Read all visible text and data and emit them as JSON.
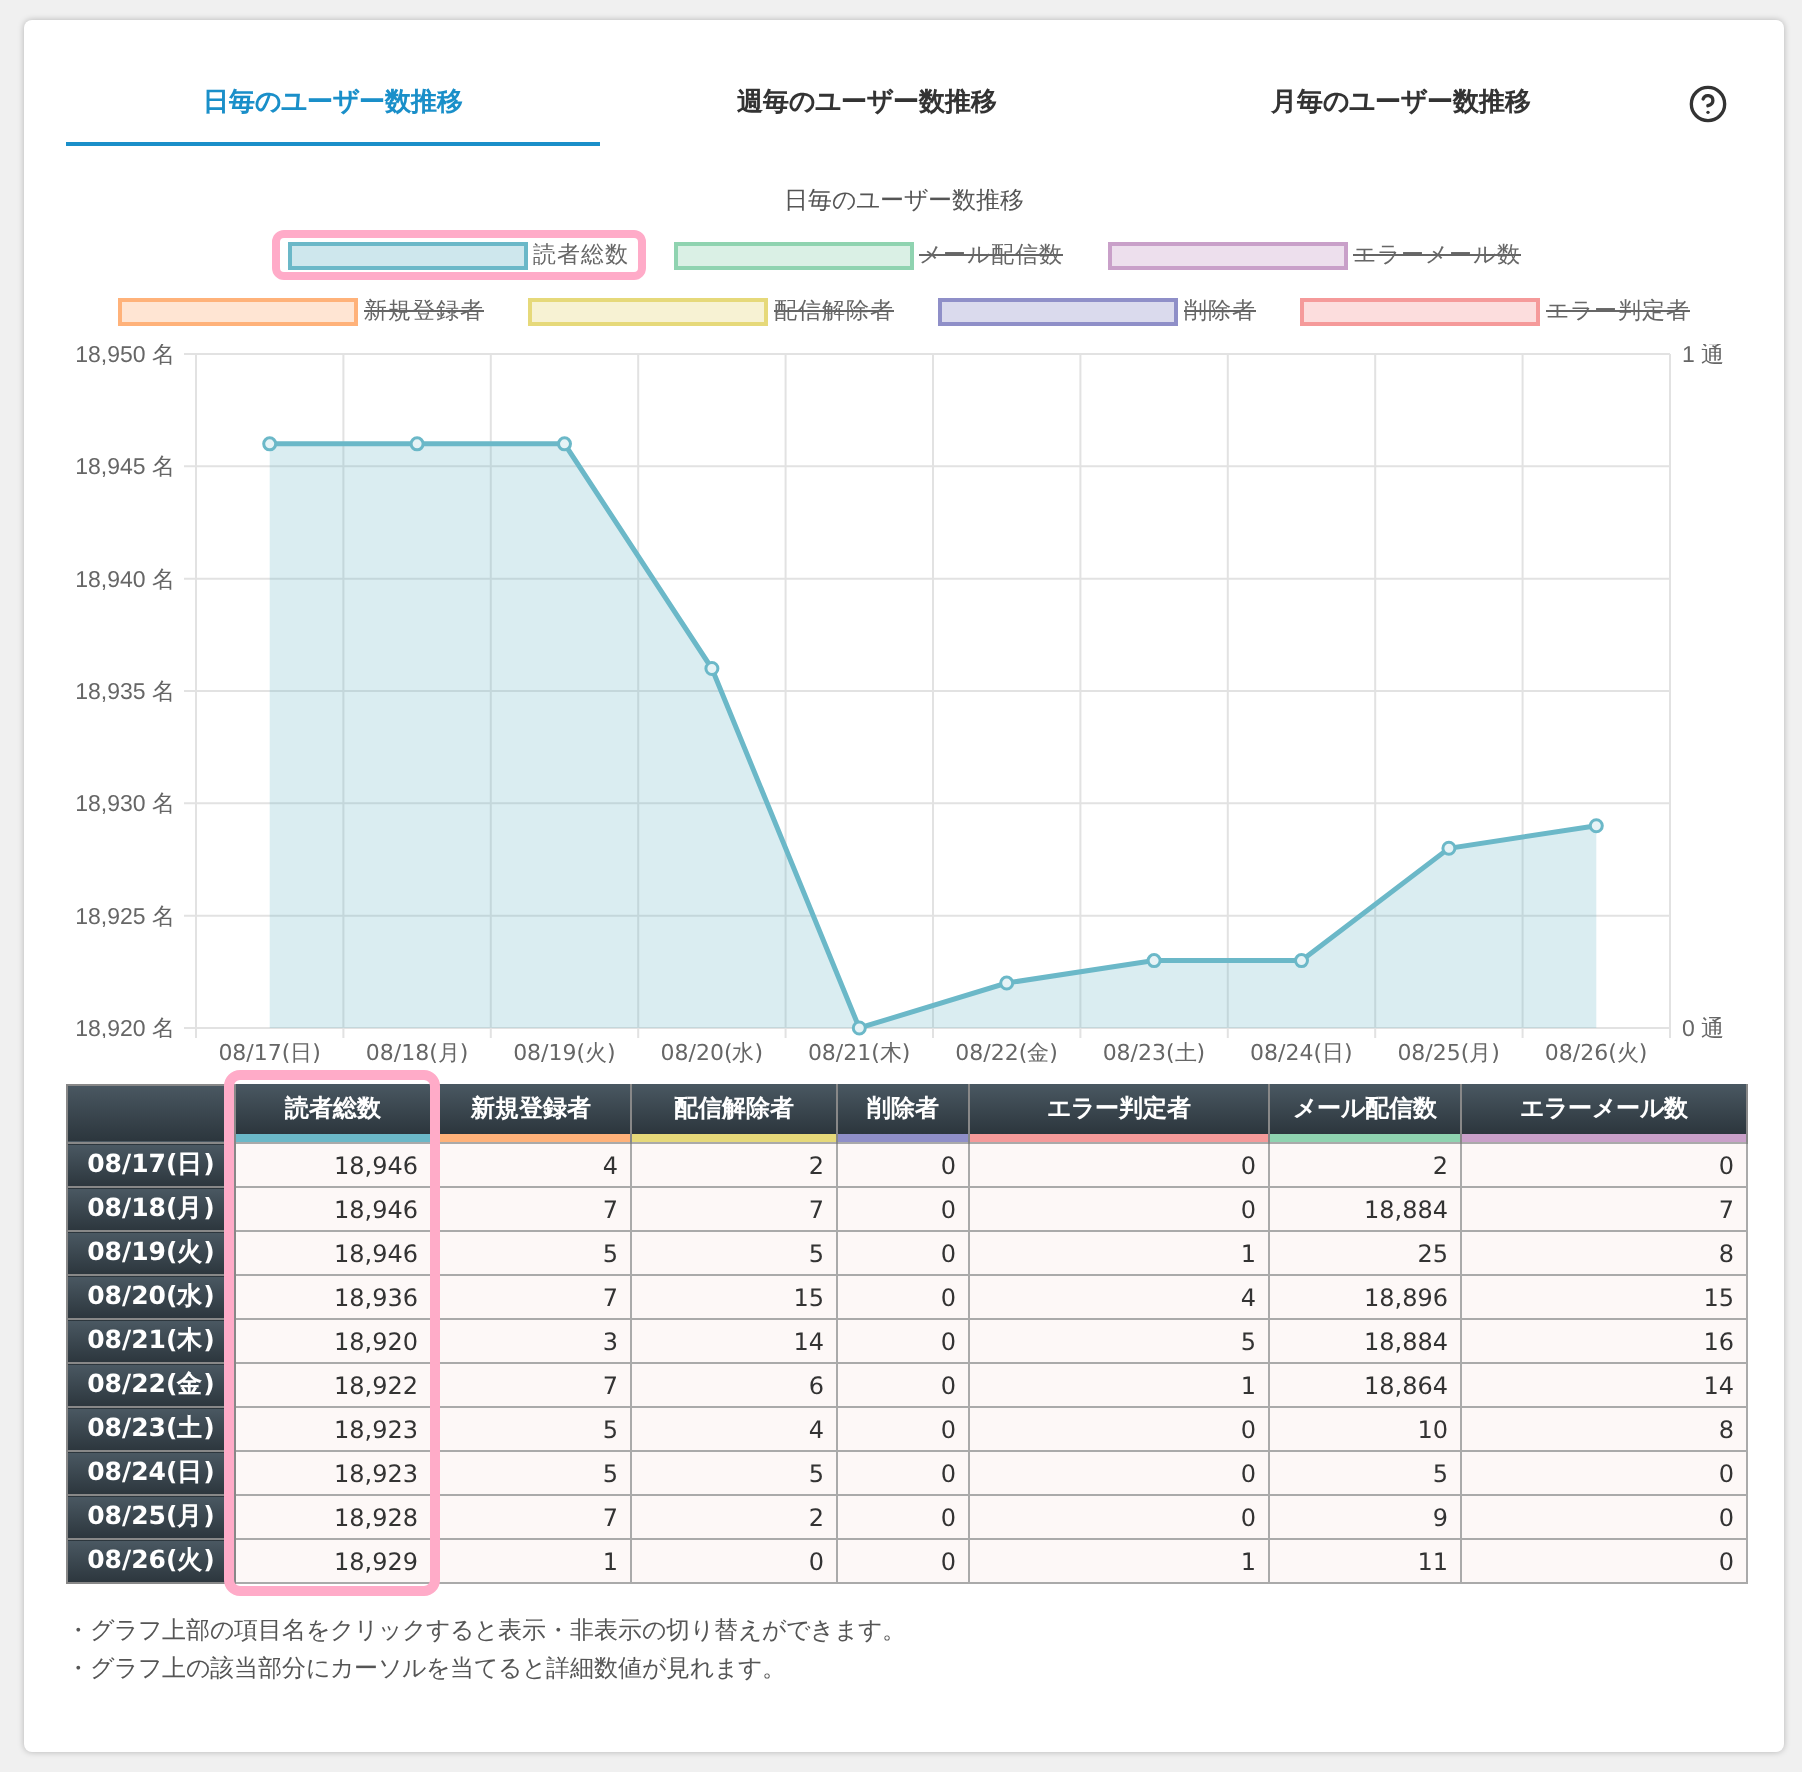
{
  "tabs": [
    {
      "label": "日毎のユーザー数推移",
      "selected": true
    },
    {
      "label": "週毎のユーザー数推移",
      "selected": false
    },
    {
      "label": "月毎のユーザー数推移",
      "selected": false
    }
  ],
  "chart": {
    "legend": [
      {
        "label": "読者総数",
        "color": "#6bb8c8",
        "hidden": false,
        "highlighted": true
      },
      {
        "label": "メール配信数",
        "color": "#8fd3b0",
        "hidden": true,
        "highlighted": false
      },
      {
        "label": "エラーメール数",
        "color": "#c9a0c9",
        "hidden": true,
        "highlighted": false
      },
      {
        "label": "新規登録者",
        "color": "#ffb27a",
        "hidden": true,
        "highlighted": false
      },
      {
        "label": "配信解除者",
        "color": "#e6d97a",
        "hidden": true,
        "highlighted": false
      },
      {
        "label": "削除者",
        "color": "#8f8fc8",
        "hidden": true,
        "highlighted": false
      },
      {
        "label": "エラー判定者",
        "color": "#f59a9a",
        "hidden": true,
        "highlighted": false
      }
    ],
    "chart_data": {
      "type": "area",
      "title": "日毎のユーザー数推移",
      "categories": [
        "08/17(日)",
        "08/18(月)",
        "08/19(火)",
        "08/20(水)",
        "08/21(木)",
        "08/22(金)",
        "08/23(土)",
        "08/24(日)",
        "08/25(月)",
        "08/26(火)"
      ],
      "series": [
        {
          "color": "#6bb8c8",
          "values": [
            18946,
            18946,
            18946,
            18936,
            18920,
            18922,
            18923,
            18923,
            18928,
            18929
          ]
        }
      ],
      "ylim": [
        18920,
        18950
      ],
      "grid": true,
      "y2lim": [
        0,
        1
      ],
      "yticks": [
        {
          "value": 18950,
          "label": "18,950 名"
        },
        {
          "value": 18945,
          "label": "18,945 名"
        },
        {
          "value": 18940,
          "label": "18,940 名"
        },
        {
          "value": 18935,
          "label": "18,935 名"
        },
        {
          "value": 18930,
          "label": "18,930 名"
        },
        {
          "value": 18925,
          "label": "18,925 名"
        },
        {
          "value": 18920,
          "label": "18,920 名"
        }
      ],
      "y2ticks": [
        {
          "value": 1,
          "label": "1 通"
        },
        {
          "value": 0,
          "label": "0 通"
        }
      ]
    }
  },
  "table": {
    "columns": [
      {
        "label": "読者総数",
        "color": "#6bb8c8",
        "highlighted": true
      },
      {
        "label": "新規登録者",
        "color": "#ffb27a",
        "highlighted": false
      },
      {
        "label": "配信解除者",
        "color": "#e6d97a",
        "highlighted": false
      },
      {
        "label": "削除者",
        "color": "#8f8fc8",
        "highlighted": false
      },
      {
        "label": "エラー判定者",
        "color": "#f59a9a",
        "highlighted": false
      },
      {
        "label": "メール配信数",
        "color": "#8fd3b0",
        "highlighted": false
      },
      {
        "label": "エラーメール数",
        "color": "#c9a0c9",
        "highlighted": false
      }
    ],
    "rows": [
      {
        "date": "08/17(日)",
        "cells": [
          "18,946",
          "4",
          "2",
          "0",
          "0",
          "2",
          "0"
        ]
      },
      {
        "date": "08/18(月)",
        "cells": [
          "18,946",
          "7",
          "7",
          "0",
          "0",
          "18,884",
          "7"
        ]
      },
      {
        "date": "08/19(火)",
        "cells": [
          "18,946",
          "5",
          "5",
          "0",
          "1",
          "25",
          "8"
        ]
      },
      {
        "date": "08/20(水)",
        "cells": [
          "18,936",
          "7",
          "15",
          "0",
          "4",
          "18,896",
          "15"
        ]
      },
      {
        "date": "08/21(木)",
        "cells": [
          "18,920",
          "3",
          "14",
          "0",
          "5",
          "18,884",
          "16"
        ]
      },
      {
        "date": "08/22(金)",
        "cells": [
          "18,922",
          "7",
          "6",
          "0",
          "1",
          "18,864",
          "14"
        ]
      },
      {
        "date": "08/23(土)",
        "cells": [
          "18,923",
          "5",
          "4",
          "0",
          "0",
          "10",
          "8"
        ]
      },
      {
        "date": "08/24(日)",
        "cells": [
          "18,923",
          "5",
          "5",
          "0",
          "0",
          "5",
          "0"
        ]
      },
      {
        "date": "08/25(月)",
        "cells": [
          "18,928",
          "7",
          "2",
          "0",
          "0",
          "9",
          "0"
        ]
      },
      {
        "date": "08/26(火)",
        "cells": [
          "18,929",
          "1",
          "0",
          "0",
          "1",
          "11",
          "0"
        ]
      }
    ]
  },
  "notes": [
    "・グラフ上部の項目名をクリックすると表示・非表示の切り替えができます。",
    "・グラフ上の該当部分にカーソルを当てると詳細数値が見れます。"
  ]
}
